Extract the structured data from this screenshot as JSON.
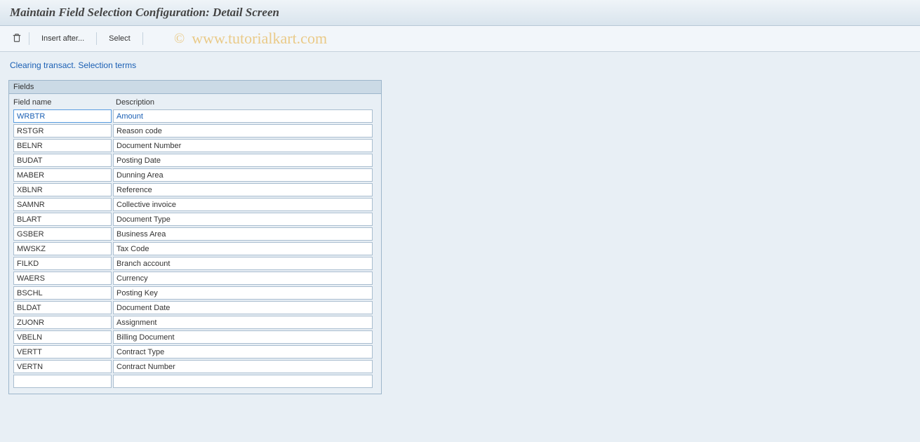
{
  "title": "Maintain Field Selection Configuration: Detail Screen",
  "toolbar": {
    "insert_after": "Insert after...",
    "select": "Select"
  },
  "breadcrumb": "Clearing transact. Selection terms",
  "panel": {
    "title": "Fields",
    "columns": {
      "name": "Field name",
      "description": "Description"
    },
    "rows": [
      {
        "name": "WRBTR",
        "description": "Amount"
      },
      {
        "name": "RSTGR",
        "description": "Reason code"
      },
      {
        "name": "BELNR",
        "description": "Document Number"
      },
      {
        "name": "BUDAT",
        "description": "Posting Date"
      },
      {
        "name": "MABER",
        "description": "Dunning Area"
      },
      {
        "name": "XBLNR",
        "description": "Reference"
      },
      {
        "name": "SAMNR",
        "description": "Collective invoice"
      },
      {
        "name": "BLART",
        "description": "Document Type"
      },
      {
        "name": "GSBER",
        "description": "Business Area"
      },
      {
        "name": "MWSKZ",
        "description": "Tax Code"
      },
      {
        "name": "FILKD",
        "description": "Branch account"
      },
      {
        "name": "WAERS",
        "description": "Currency"
      },
      {
        "name": "BSCHL",
        "description": "Posting Key"
      },
      {
        "name": "BLDAT",
        "description": "Document Date"
      },
      {
        "name": "ZUONR",
        "description": "Assignment"
      },
      {
        "name": "VBELN",
        "description": "Billing Document"
      },
      {
        "name": "VERTT",
        "description": "Contract Type"
      },
      {
        "name": "VERTN",
        "description": "Contract Number"
      },
      {
        "name": "",
        "description": ""
      }
    ]
  },
  "watermark": {
    "copyright": "©",
    "text": "www.tutorialkart.com"
  }
}
